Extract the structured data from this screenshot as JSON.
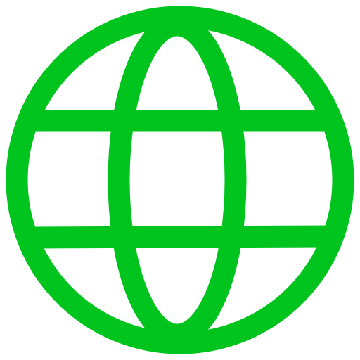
{
  "icon": {
    "name": "globe-icon",
    "color": "#00c41e",
    "background": "#ffffff"
  }
}
